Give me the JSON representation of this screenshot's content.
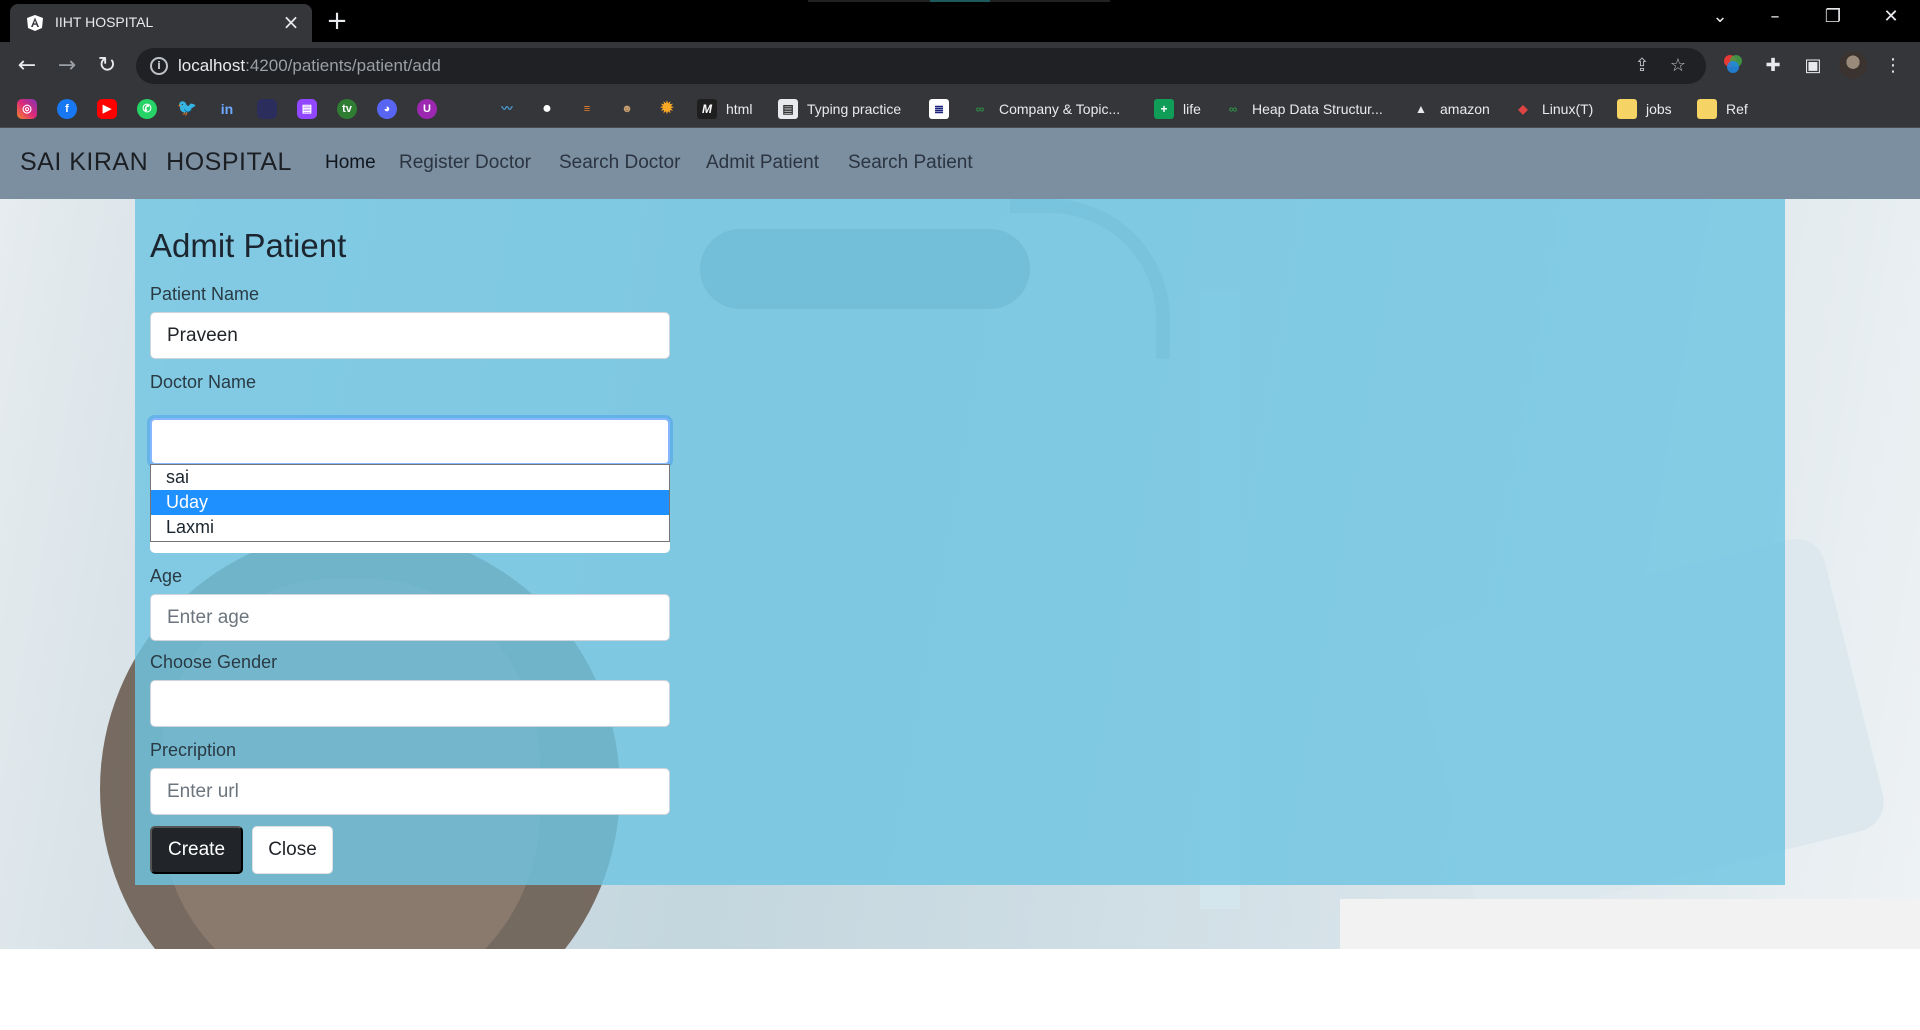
{
  "browser": {
    "tab_title": "IIHT HOSPITAL",
    "url_host": "localhost",
    "url_path": ":4200/patients/patient/add"
  },
  "bookmarks": [
    {
      "label": "html",
      "icon": "m-icon",
      "color": "#1f1f1f"
    },
    {
      "label": "Typing practice",
      "icon": "document-icon",
      "color": "#e8eaed"
    },
    {
      "label": "",
      "icon": "book-icon",
      "color": "#ffffff"
    },
    {
      "label": "Company & Topic...",
      "icon": "gfg-icon",
      "color": "#2f8d46"
    },
    {
      "label": "life",
      "icon": "plus-icon",
      "color": "#0f9d58"
    },
    {
      "label": "Heap Data Structur...",
      "icon": "gfg-icon",
      "color": "#2f8d46"
    },
    {
      "label": "amazon",
      "icon": "mountain-icon",
      "color": "#e8eaed"
    },
    {
      "label": "Linux(T)",
      "icon": "box-icon",
      "color": "#d44"
    },
    {
      "label": "jobs",
      "icon": "folder-icon",
      "color": "#f6d365"
    },
    {
      "label": "Ref",
      "icon": "folder-icon",
      "color": "#f6d365"
    }
  ],
  "navbar": {
    "brand_1": "SAI KIRAN",
    "brand_2": "HOSPITAL",
    "links": [
      "Home",
      "Register Doctor",
      "Search Doctor",
      "Admit Patient",
      "Search Patient"
    ]
  },
  "form": {
    "title": "Admit Patient",
    "patient_name_label": "Patient Name",
    "patient_name_value": "Praveen",
    "doctor_name_label": "Doctor Name",
    "doctor_options": [
      "sai",
      "Uday",
      "Laxmi"
    ],
    "doctor_selected_index": 1,
    "age_label": "Age",
    "age_placeholder": "Enter age",
    "gender_label": "Choose Gender",
    "prescription_label": "Precription",
    "prescription_placeholder": "Enter url",
    "create_label": "Create",
    "close_label": "Close"
  }
}
